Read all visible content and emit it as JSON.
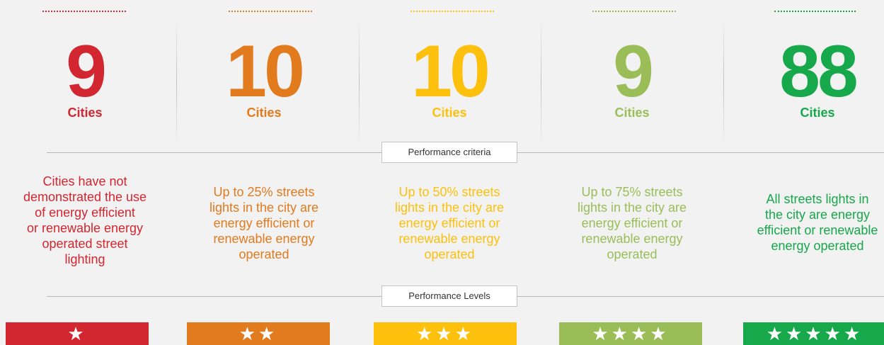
{
  "unit_label": "Cities",
  "criteria_label": "Performance criteria",
  "levels_label": "Performance Levels",
  "columns": [
    {
      "count": "9",
      "color": "#d22630",
      "description_lines": [
        "Cities have not",
        "demonstrated the use",
        "of energy efficient",
        "or renewable energy",
        "operated street",
        "lighting"
      ],
      "stars": "★",
      "star_count": 1
    },
    {
      "count": "10",
      "color": "#e27a1e",
      "description_lines": [
        "Up to 25% streets",
        "lights  in the city are",
        "energy efficient or",
        "renewable energy",
        "operated"
      ],
      "stars": "★★",
      "star_count": 2
    },
    {
      "count": "10",
      "color": "#fcc00d",
      "description_lines": [
        "Up to 50% streets",
        "lights  in the city are",
        "energy efficient or",
        "renewable energy",
        "operated"
      ],
      "stars": "★★★",
      "star_count": 3
    },
    {
      "count": "9",
      "color": "#9bbd57",
      "description_lines": [
        "Up to 75% streets",
        "lights  in the city are",
        "energy efficient or",
        "renewable energy",
        "operated"
      ],
      "stars": "★★★★",
      "star_count": 4
    },
    {
      "count": "88",
      "color": "#16a84b",
      "description_lines": [
        "All streets lights  in",
        "the city are energy",
        "efficient or renewable",
        "energy operated"
      ],
      "stars": "★★★★★",
      "star_count": 5
    }
  ]
}
